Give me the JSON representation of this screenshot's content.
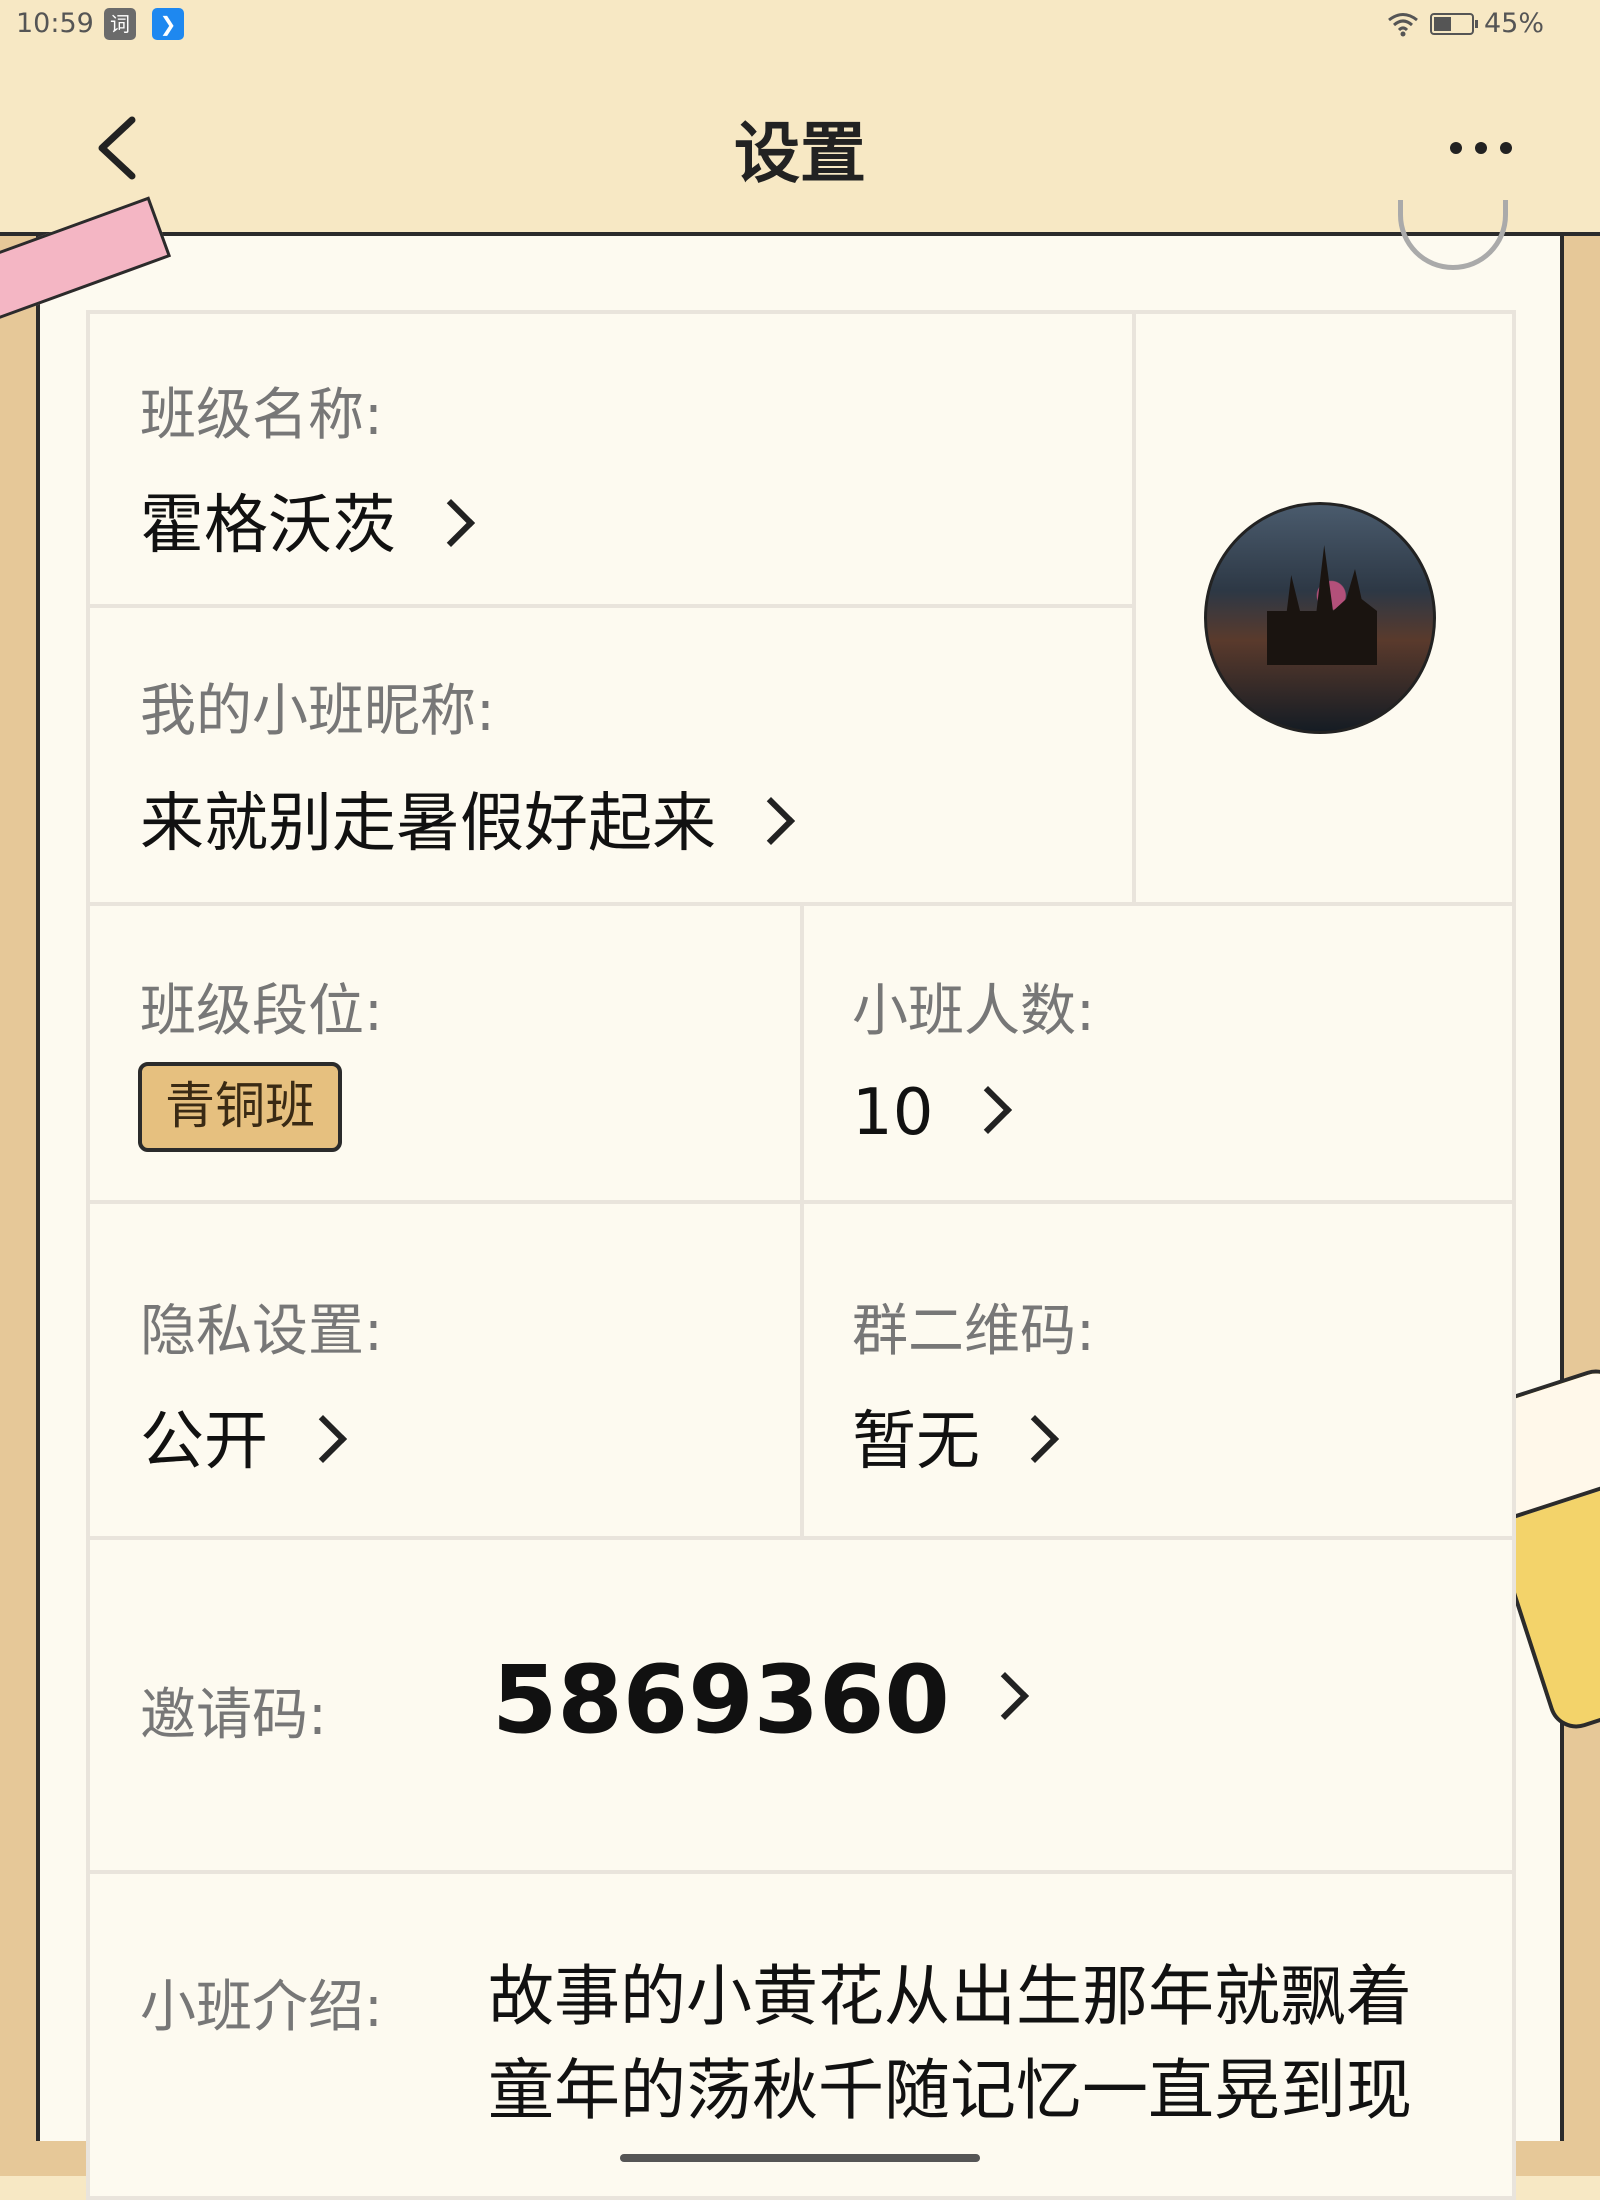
{
  "status_bar": {
    "time": "10:59",
    "app_icon_1": "词",
    "app_icon_2": "❯",
    "battery": "45%",
    "icons": [
      "wifi-icon",
      "battery-icon"
    ]
  },
  "header": {
    "title": "设置",
    "back_icon": "chevron-left-icon",
    "more_icon": "more-dots-icon"
  },
  "class_info": {
    "class_name_label": "班级名称:",
    "class_name_value": "霍格沃茨",
    "nickname_label": "我的小班昵称:",
    "nickname_value": "来就别走暑假好起来",
    "rank_label": "班级段位:",
    "rank_value": "青铜班",
    "member_count_label": "小班人数:",
    "member_count_value": "10",
    "privacy_label": "隐私设置:",
    "privacy_value": "公开",
    "qr_label": "群二维码:",
    "qr_value": "暂无",
    "invite_label": "邀请码:",
    "invite_value": "5869360",
    "intro_label": "小班介绍:",
    "intro_value": "故事的小黄花从出生那年就飘着童年的荡秋千随记忆一直晃到现"
  },
  "colors": {
    "header_bg": "#f7e8c4",
    "board_bg": "#fdfaf0",
    "badge_bg": "#e6c07f",
    "label_text": "#777777",
    "value_text": "#111111"
  }
}
